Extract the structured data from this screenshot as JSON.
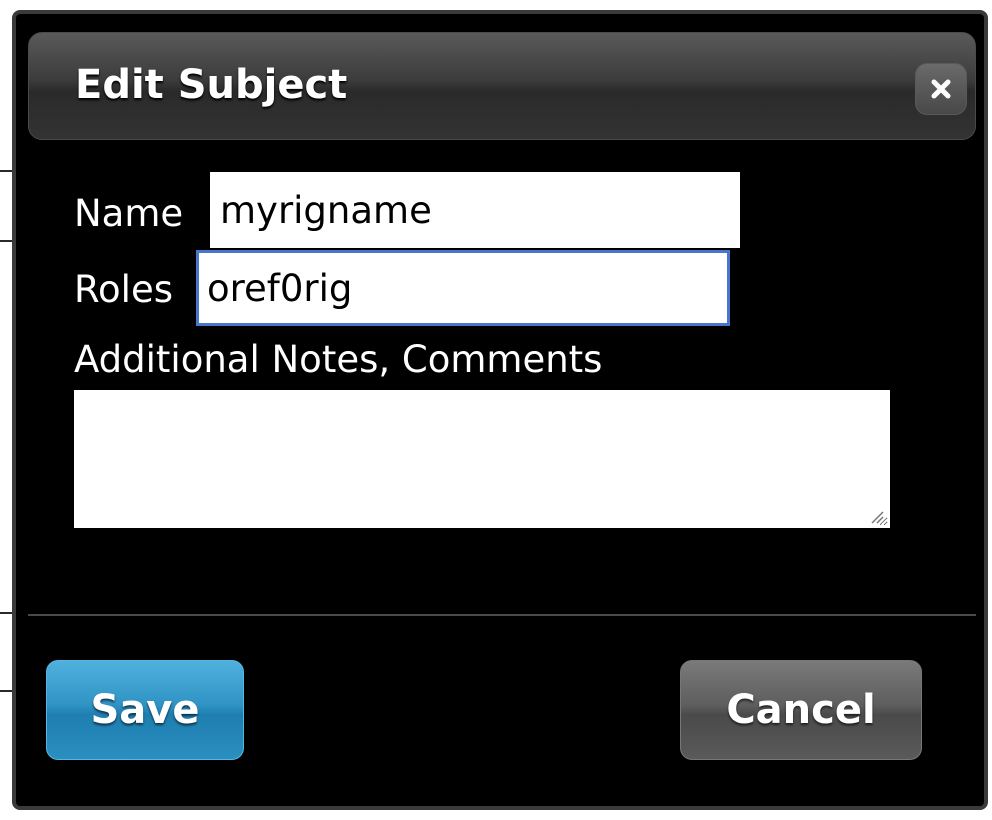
{
  "dialog": {
    "title": "Edit Subject",
    "close_icon": "close-icon"
  },
  "form": {
    "name_label": "Name",
    "name_value": "myrigname",
    "roles_label": "Roles",
    "roles_value": "oref0rig",
    "notes_label": "Additional Notes, Comments",
    "notes_value": ""
  },
  "footer": {
    "save_label": "Save",
    "cancel_label": "Cancel"
  },
  "colors": {
    "save_accent": "#2f93c4",
    "cancel_gray": "#5e5e5e",
    "focus_border": "#4a76c9",
    "dialog_bg": "#000000"
  }
}
